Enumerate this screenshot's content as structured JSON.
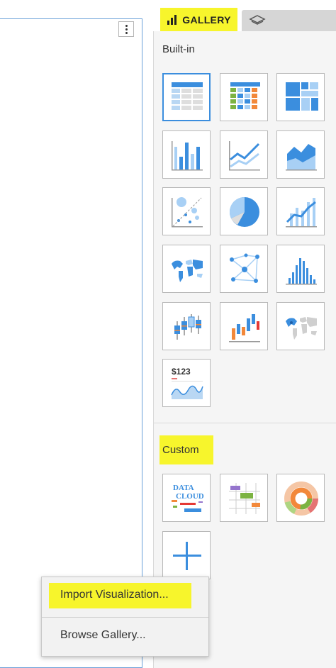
{
  "panel": {
    "tabs": [
      {
        "label": "GALLERY",
        "icon": "bar-chart-icon",
        "active": true
      },
      {
        "label": "",
        "icon": "layers-icon",
        "active": false
      }
    ],
    "builtin_title": "Built-in",
    "custom_title": "Custom",
    "builtin_items": [
      {
        "name": "grid-table",
        "icon": "grid-table-icon",
        "selected": true
      },
      {
        "name": "cross-tab",
        "icon": "crosstab-icon"
      },
      {
        "name": "heat-map",
        "icon": "heatmap-icon"
      },
      {
        "name": "bar-chart",
        "icon": "bar-chart-icon"
      },
      {
        "name": "line-chart",
        "icon": "line-chart-icon"
      },
      {
        "name": "area-chart",
        "icon": "area-chart-icon"
      },
      {
        "name": "bubble-chart",
        "icon": "bubble-chart-icon"
      },
      {
        "name": "pie-chart",
        "icon": "pie-chart-icon"
      },
      {
        "name": "combo-chart",
        "icon": "combo-chart-icon"
      },
      {
        "name": "map",
        "icon": "world-map-icon"
      },
      {
        "name": "network",
        "icon": "network-icon"
      },
      {
        "name": "histogram",
        "icon": "histogram-icon"
      },
      {
        "name": "box-plot",
        "icon": "box-plot-icon"
      },
      {
        "name": "waterfall",
        "icon": "waterfall-icon"
      },
      {
        "name": "geo-map",
        "icon": "geo-map-icon"
      },
      {
        "name": "kpi",
        "icon": "kpi-icon",
        "text": "$123"
      }
    ],
    "custom_items": [
      {
        "name": "data-cloud",
        "icon": "word-cloud-icon",
        "text_line1": "DATA",
        "text_line2": "CLOUD"
      },
      {
        "name": "gantt",
        "icon": "gantt-icon"
      },
      {
        "name": "sunburst",
        "icon": "sunburst-icon"
      },
      {
        "name": "add-custom",
        "icon": "plus-icon"
      }
    ]
  },
  "menu": {
    "import_label": "Import Visualization...",
    "browse_label": "Browse Gallery..."
  },
  "colors": {
    "highlight": "#f7f52c",
    "accent": "#3b8ede",
    "selected_border": "#3b8ede"
  }
}
